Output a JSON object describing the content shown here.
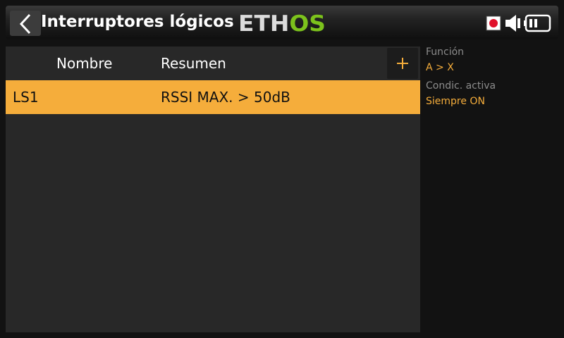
{
  "header": {
    "title": "Interruptores lógicos",
    "logo_text": "ETHOS",
    "icons": [
      "back-arrow-icon",
      "record-icon",
      "speaker-icon",
      "battery-icon"
    ]
  },
  "table": {
    "columns": [
      "Nombre",
      "Resumen"
    ],
    "add_label": "+",
    "rows": [
      {
        "name": "LS1",
        "summary": "RSSI MAX. > 50dB",
        "selected": true
      }
    ]
  },
  "details": {
    "function_label": "Función",
    "function_value": "A > X",
    "active_label": "Condic. activa",
    "active_value": "Siempre ON"
  },
  "colors": {
    "accent": "#f5ad3b",
    "logo_green": "#7cc21c",
    "record_red": "#e0102a"
  }
}
